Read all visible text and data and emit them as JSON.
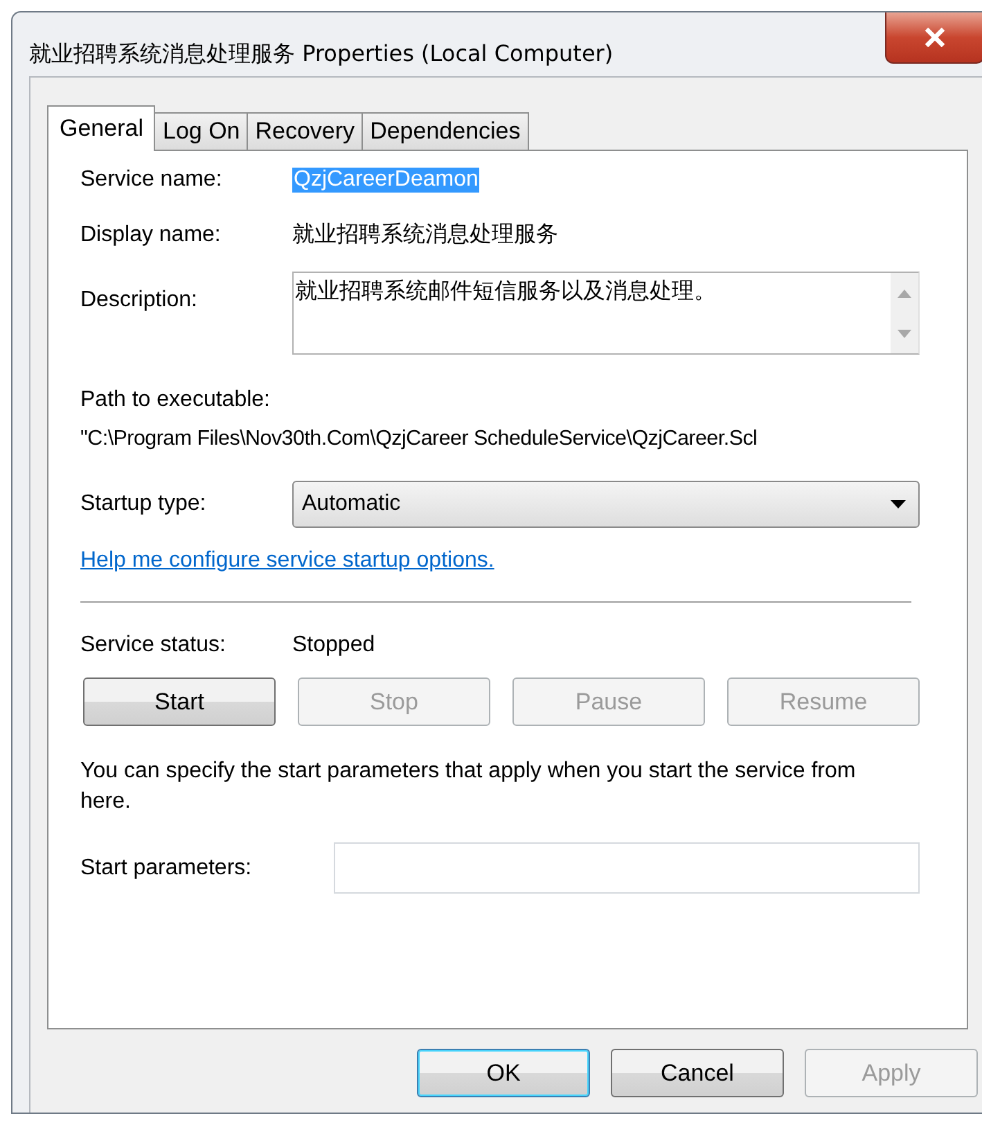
{
  "window": {
    "title": "就业招聘系统消息处理服务 Properties (Local Computer)"
  },
  "tabs": [
    {
      "label": "General",
      "selected": true
    },
    {
      "label": "Log On",
      "selected": false
    },
    {
      "label": "Recovery",
      "selected": false
    },
    {
      "label": "Dependencies",
      "selected": false
    }
  ],
  "service_name": {
    "label": "Service name:",
    "value": "QzjCareerDeamon",
    "highlighted": true
  },
  "display_name": {
    "label": "Display name:",
    "value": "就业招聘系统消息处理服务"
  },
  "description": {
    "label": "Description:",
    "value": "就业招聘系统邮件短信服务以及消息处理。"
  },
  "path": {
    "label": "Path to executable:",
    "value": "\"C:\\Program Files\\Nov30th.Com\\QzjCareer ScheduleService\\QzjCareer.Scl"
  },
  "startup_type": {
    "label": "Startup type:",
    "value": "Automatic"
  },
  "help_link": "Help me configure service startup options.",
  "service_status": {
    "label": "Service status:",
    "value": "Stopped"
  },
  "service_buttons": [
    {
      "label": "Start",
      "disabled": false
    },
    {
      "label": "Stop",
      "disabled": true
    },
    {
      "label": "Pause",
      "disabled": true
    },
    {
      "label": "Resume",
      "disabled": true
    }
  ],
  "hint": "You can specify the start parameters that apply when you start the service from here.",
  "start_parameters": {
    "label": "Start parameters:"
  },
  "dialog_buttons": [
    {
      "label": "OK",
      "default": true,
      "disabled": false
    },
    {
      "label": "Cancel",
      "default": false,
      "disabled": false
    },
    {
      "label": "Apply",
      "default": false,
      "disabled": true
    }
  ]
}
